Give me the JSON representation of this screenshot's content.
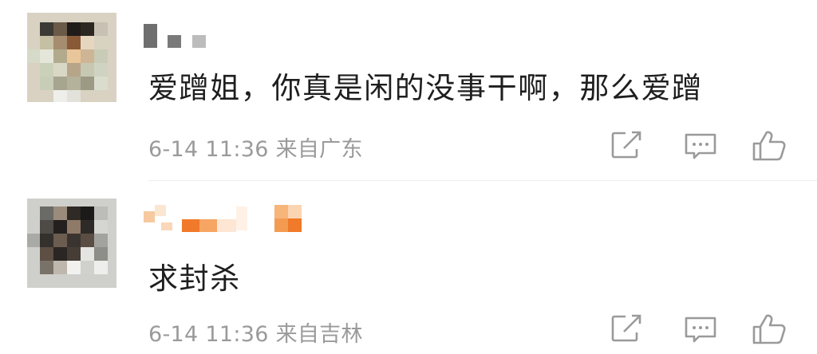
{
  "comments": [
    {
      "text": "爱蹭姐，你真是闲的没事干啊，那么爱蹭",
      "date": "6-14",
      "time": "11:36",
      "location": "来自广东",
      "avatar_icon": "user-avatar-pixelated",
      "actions": [
        "share-icon",
        "reply-icon",
        "like-icon"
      ]
    },
    {
      "text": "求封杀",
      "date": "6-14",
      "time": "11:36",
      "location": "来自吉林",
      "avatar_icon": "user-avatar-pixelated",
      "actions": [
        "share-icon",
        "reply-icon",
        "like-icon"
      ]
    }
  ],
  "colors": {
    "text": "#1e1e1e",
    "meta": "#9a9a9a",
    "icon": "#9a9a9a",
    "divider": "#ececec",
    "name_accent": "#f07a2a"
  }
}
